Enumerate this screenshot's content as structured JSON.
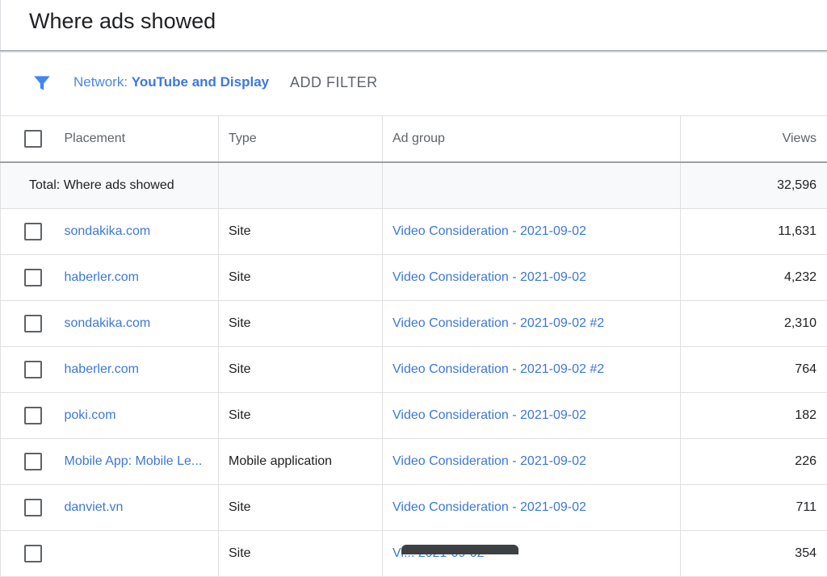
{
  "header": {
    "title": "Where ads showed"
  },
  "filter": {
    "icon": "filter-icon",
    "key": "Network: ",
    "value": "YouTube and Display",
    "add_label": "ADD FILTER",
    "icon_color": "#4285f4"
  },
  "table": {
    "columns": {
      "placement": "Placement",
      "type": "Type",
      "ad_group": "Ad group",
      "views": "Views"
    },
    "total": {
      "label": "Total: Where ads showed",
      "views": "32,596"
    },
    "rows": [
      {
        "placement": "sondakika.com",
        "type": "Site",
        "ad_group": "Video Consideration - 2021-09-02",
        "views": "11,631"
      },
      {
        "placement": "haberler.com",
        "type": "Site",
        "ad_group": "Video Consideration - 2021-09-02",
        "views": "4,232"
      },
      {
        "placement": "sondakika.com",
        "type": "Site",
        "ad_group": "Video Consideration - 2021-09-02 #2",
        "views": "2,310"
      },
      {
        "placement": "haberler.com",
        "type": "Site",
        "ad_group": "Video Consideration - 2021-09-02 #2",
        "views": "764"
      },
      {
        "placement": "poki.com",
        "type": "Site",
        "ad_group": "Video Consideration - 2021-09-02",
        "views": "182"
      },
      {
        "placement": "Mobile App: Mobile Le...",
        "type": "Mobile application",
        "ad_group": "Video Consideration - 2021-09-02",
        "views": "226"
      },
      {
        "placement": "danviet.vn",
        "type": "Site",
        "ad_group": "Video Consideration - 2021-09-02",
        "views": "711"
      },
      {
        "placement": "",
        "type": "Site",
        "ad_group": "Vi... 2021-09-02",
        "views": "354"
      }
    ]
  }
}
